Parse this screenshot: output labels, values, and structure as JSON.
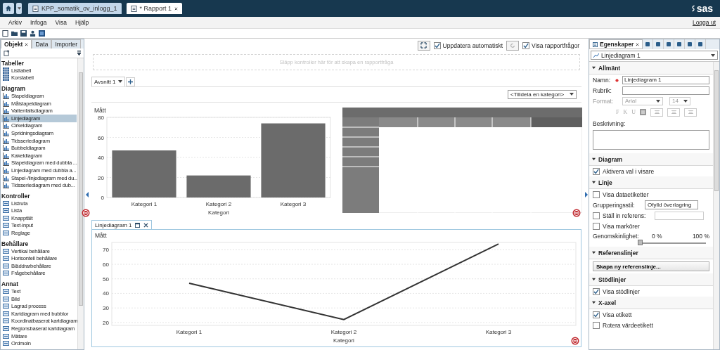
{
  "app_bar": {
    "tabs": [
      {
        "label": "KPP_somatik_ov_inlogg_1",
        "selected": false
      },
      {
        "label": "* Rapport 1",
        "selected": true
      }
    ],
    "logo": "sas"
  },
  "menu": [
    "Arkiv",
    "Infoga",
    "Visa",
    "Hjälp"
  ],
  "logout": "Logga ut",
  "object_panel": {
    "tabs": [
      {
        "label": "Objekt",
        "selected": true
      },
      {
        "label": "Data",
        "selected": false
      },
      {
        "label": "Importer",
        "selected": false
      }
    ],
    "groups": [
      {
        "title": "Tabeller",
        "items": [
          {
            "label": "Listtabell",
            "selected": false
          },
          {
            "label": "Korstabell",
            "selected": false
          }
        ]
      },
      {
        "title": "Diagram",
        "items": [
          {
            "label": "Stapeldiagram",
            "selected": false
          },
          {
            "label": "Målstapeldiagram",
            "selected": false
          },
          {
            "label": "Vattenfallsdiagram",
            "selected": false
          },
          {
            "label": "Linjediagram",
            "selected": true
          },
          {
            "label": "Cirkeldiagram",
            "selected": false
          },
          {
            "label": "Spridningsdiagram",
            "selected": false
          },
          {
            "label": "Tidsseriediagram",
            "selected": false
          },
          {
            "label": "Bubbeldiagram",
            "selected": false
          },
          {
            "label": "Kakeldiagram",
            "selected": false
          },
          {
            "label": "Stapeldiagram med dubbla ...",
            "selected": false
          },
          {
            "label": "Linjediagram med dubbla a...",
            "selected": false
          },
          {
            "label": "Stapel-/linjediagram med du...",
            "selected": false
          },
          {
            "label": "Tidsseriediagram med dub...",
            "selected": false
          }
        ]
      },
      {
        "title": "Kontroller",
        "items": [
          {
            "label": "Listruta",
            "selected": false
          },
          {
            "label": "Lista",
            "selected": false
          },
          {
            "label": "Knappfält",
            "selected": false
          },
          {
            "label": "Text-input",
            "selected": false
          },
          {
            "label": "Reglage",
            "selected": false
          }
        ]
      },
      {
        "title": "Behållare",
        "items": [
          {
            "label": "Vertikal behållare",
            "selected": false
          },
          {
            "label": "Horisontell behållare",
            "selected": false
          },
          {
            "label": "Bläddrarbehållare",
            "selected": false
          },
          {
            "label": "Frågebehållare",
            "selected": false
          }
        ]
      },
      {
        "title": "Annat",
        "items": [
          {
            "label": "Text",
            "selected": false
          },
          {
            "label": "Bild",
            "selected": false
          },
          {
            "label": "Lagrad process",
            "selected": false
          },
          {
            "label": "Kartdiagram med bubblor",
            "selected": false
          },
          {
            "label": "Koordinatbaserat kartdiagram",
            "selected": false
          },
          {
            "label": "Regionsbaserat kartdiagram",
            "selected": false
          },
          {
            "label": "Mätare",
            "selected": false
          },
          {
            "label": "Ordmoln",
            "selected": false
          }
        ]
      }
    ]
  },
  "report": {
    "auto_update": {
      "label": "Uppdatera automatiskt",
      "checked": true
    },
    "show_prompts": {
      "label": "Visa rapportfrågor",
      "checked": true
    },
    "drop_zone": "Släpp kontroller här för att skapa en rapportfråga",
    "section_tab": "Avsnitt 1",
    "category_select": "<Tilldela en kategori>",
    "bar_chart": {
      "chart_data": {
        "type": "bar",
        "xlabel": "Kategori",
        "ylabel": "Mått",
        "categories": [
          "Kategori 1",
          "Kategori 2",
          "Kategori 3"
        ],
        "values": [
          47,
          22,
          74
        ],
        "ylim": [
          0,
          80
        ],
        "yticks": [
          0,
          20,
          40,
          60,
          80
        ],
        "grid": true
      }
    },
    "line_chart": {
      "title": "Linjediagram 1",
      "chart_data": {
        "type": "line",
        "xlabel": "Kategori",
        "ylabel": "Mått",
        "categories": [
          "Kategori 1",
          "Kategori 2",
          "Kategori 3"
        ],
        "values": [
          47,
          22,
          74
        ],
        "ylim": [
          18,
          75
        ],
        "yticks": [
          20,
          30,
          40,
          50,
          60,
          70
        ],
        "grid": true
      }
    }
  },
  "properties": {
    "tab": "Egenskaper",
    "selector": "Linjediagram 1",
    "sections": [
      {
        "title": "Allmänt",
        "expanded": true,
        "rows": [
          {
            "kind": "field",
            "label": "Namn:",
            "value": "Linjediagram 1",
            "required": true
          },
          {
            "kind": "field",
            "label": "Rubrik:",
            "required": false
          },
          {
            "kind": "font",
            "label": "Format:",
            "font": "Arial",
            "size": "14",
            "disabled": true
          },
          {
            "kind": "style_buttons",
            "buttons": [
              "F",
              "K",
              "U"
            ]
          },
          {
            "kind": "textarea",
            "label": "Beskrivning:"
          }
        ]
      },
      {
        "title": "Diagram",
        "expanded": true,
        "rows": [
          {
            "kind": "checkbox",
            "label": "Aktivera val i visare",
            "checked": true
          }
        ]
      },
      {
        "title": "Linje",
        "expanded": true,
        "rows": [
          {
            "kind": "checkbox",
            "label": "Visa dataetiketter",
            "checked": false
          },
          {
            "kind": "select",
            "label": "Grupperingsstil:",
            "value": "Ofylld överlagring"
          },
          {
            "kind": "checkbox_field",
            "label": "Ställ in referens:",
            "checked": false
          },
          {
            "kind": "checkbox",
            "label": "Visa markörer",
            "checked": false
          },
          {
            "kind": "slider",
            "label": "Genomskinlighet:",
            "min_label": "0 %",
            "max_label": "100 %",
            "level": 0
          }
        ]
      },
      {
        "title": "Referenslinjer",
        "expanded": true,
        "rows": [
          {
            "kind": "button",
            "label": "Skapa ny referenslinje..."
          }
        ]
      },
      {
        "title": "Stödlinjer",
        "expanded": true,
        "rows": [
          {
            "kind": "checkbox",
            "label": "Visa stödlinjer",
            "checked": true
          }
        ]
      },
      {
        "title": "X-axel",
        "expanded": true,
        "rows": [
          {
            "kind": "checkbox",
            "label": "Visa etikett",
            "checked": true
          },
          {
            "kind": "checkbox",
            "label": "Rotera värdeetikett",
            "checked": false
          }
        ]
      }
    ]
  }
}
